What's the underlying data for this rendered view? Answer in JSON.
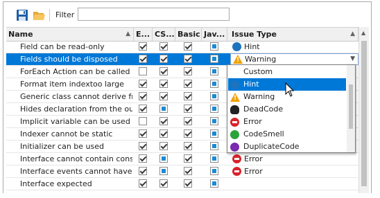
{
  "toolbar": {
    "save_icon": "save-icon",
    "open_icon": "open-folder-icon",
    "filter_label": "Filter",
    "filter_value": ""
  },
  "columns": [
    "Name",
    "E...",
    "CS...",
    "Basic",
    "Jav...",
    "Issue Type"
  ],
  "rows": [
    {
      "name": "Field can be read-only",
      "c": [
        "on",
        "on",
        "on",
        "ind"
      ],
      "issue": "Hint",
      "icon": "hint"
    },
    {
      "name": "Fields should be disposed",
      "c": [
        "on",
        "on",
        "on",
        "ind"
      ],
      "issue": "Warning",
      "icon": "warning",
      "selected": true
    },
    {
      "name": "ForEach Action can be called",
      "c": [
        "off",
        "on",
        "on",
        "ind"
      ],
      "issue": "",
      "icon": ""
    },
    {
      "name": "Format item indextoo large",
      "c": [
        "on",
        "on",
        "on",
        "ind"
      ],
      "issue": "",
      "icon": ""
    },
    {
      "name": "Generic class cannot derive from",
      "c": [
        "on",
        "on",
        "on",
        "ind"
      ],
      "issue": "",
      "icon": ""
    },
    {
      "name": "Hides declaration from the oute",
      "c": [
        "on",
        "ind",
        "on",
        "ind"
      ],
      "issue": "",
      "icon": ""
    },
    {
      "name": "Implicit variable can be used",
      "c": [
        "off",
        "on",
        "on",
        "ind"
      ],
      "issue": "",
      "icon": ""
    },
    {
      "name": "Indexer cannot be static",
      "c": [
        "on",
        "on",
        "on",
        "ind"
      ],
      "issue": "",
      "icon": ""
    },
    {
      "name": "Initializer can be used",
      "c": [
        "on",
        "on",
        "on",
        "ind"
      ],
      "issue": "",
      "icon": ""
    },
    {
      "name": "Interface cannot contain constru",
      "c": [
        "on",
        "ind",
        "on",
        "ind"
      ],
      "issue": "Error",
      "icon": "error"
    },
    {
      "name": "Interface events cannot have adc",
      "c": [
        "on",
        "ind",
        "on",
        "ind"
      ],
      "issue": "Error",
      "icon": "error"
    },
    {
      "name": "Interface expected",
      "c": [
        "on",
        "on",
        "on",
        "ind"
      ],
      "issue": "",
      "icon": ""
    }
  ],
  "dropdown": {
    "items": [
      {
        "label": "Custom",
        "icon": ""
      },
      {
        "label": "Hint",
        "icon": "hint",
        "highlighted": true
      },
      {
        "label": "Warning",
        "icon": "warning"
      },
      {
        "label": "DeadCode",
        "icon": "dead"
      },
      {
        "label": "Error",
        "icon": "error"
      },
      {
        "label": "CodeSmell",
        "icon": "smell"
      },
      {
        "label": "DuplicateCode",
        "icon": "dup"
      }
    ]
  },
  "colors": {
    "selection": "#0078d7",
    "hint": "#1e73be",
    "error": "#d9222a",
    "warning": "#f2a100"
  }
}
